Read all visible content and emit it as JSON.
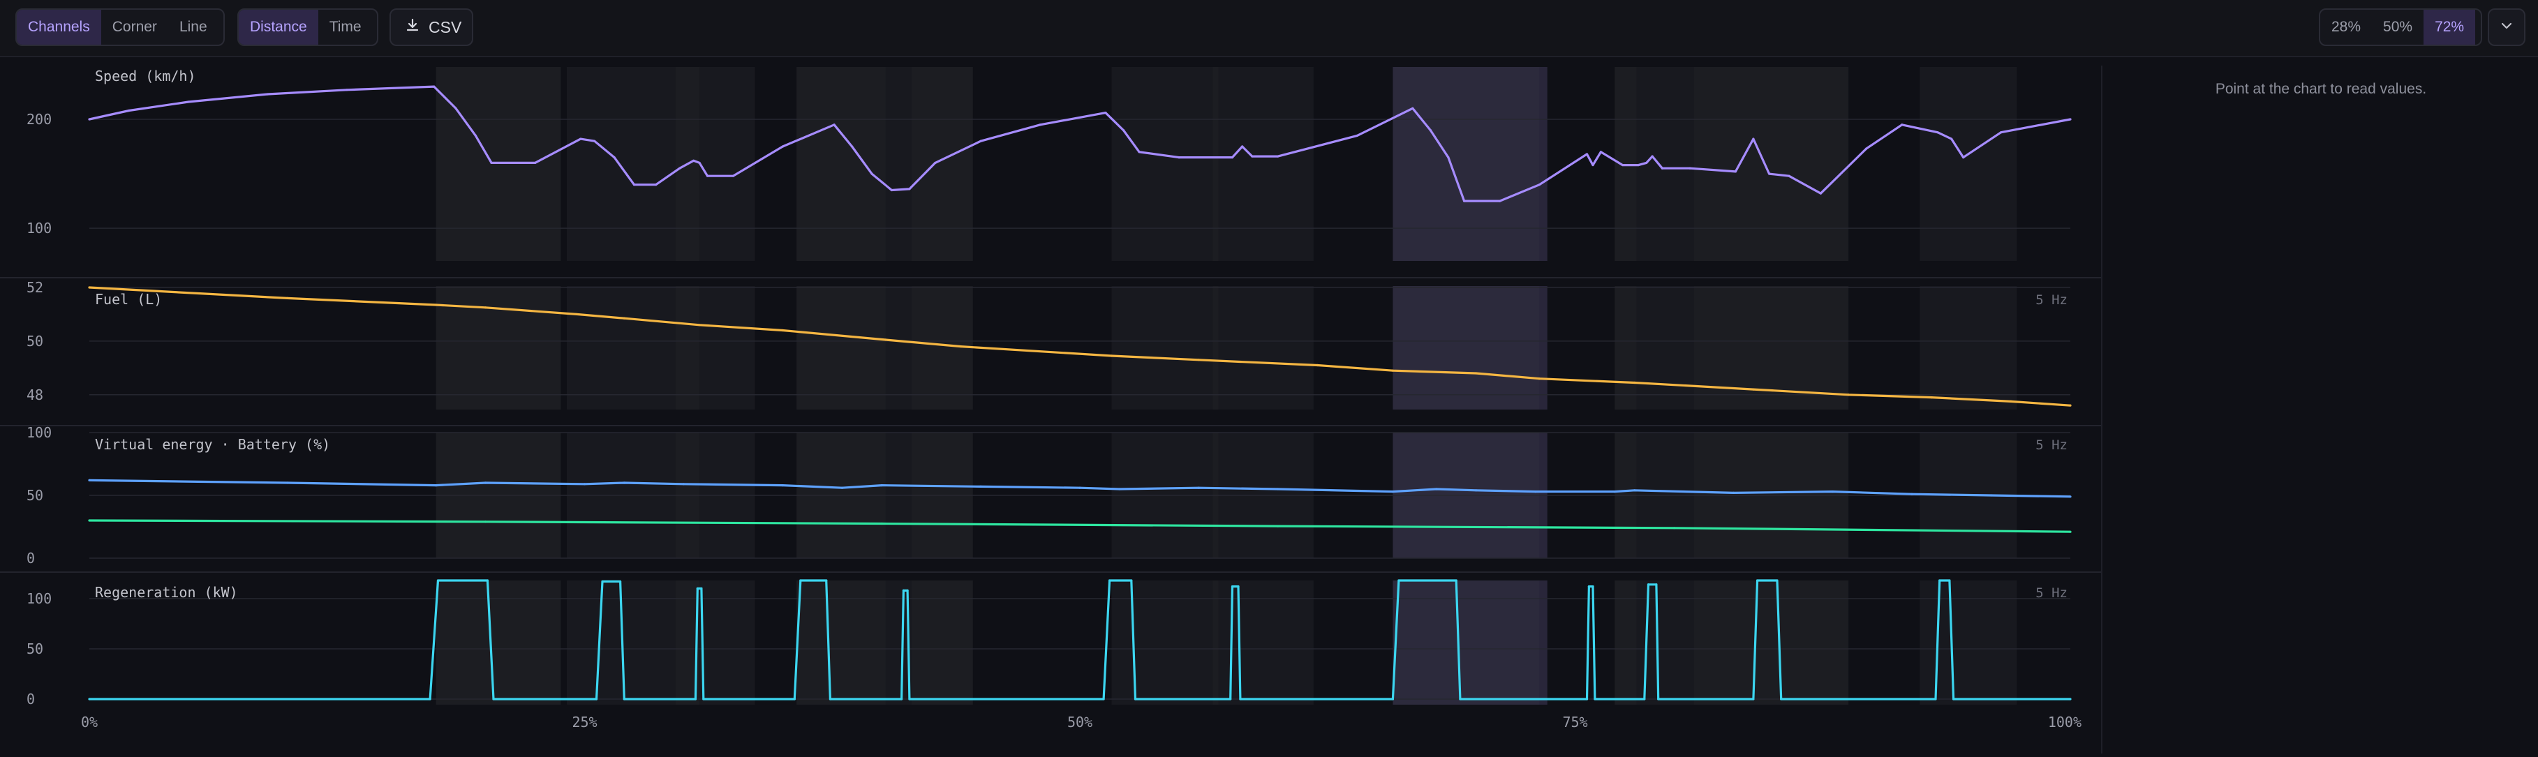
{
  "toolbar": {
    "view_mode": {
      "options": [
        "Channels",
        "Corner",
        "Line"
      ],
      "selected": "Channels"
    },
    "axis_mode": {
      "options": [
        "Distance",
        "Time"
      ],
      "selected": "Distance"
    },
    "export_label": "CSV",
    "zoom": {
      "options": [
        "28%",
        "50%",
        "72%"
      ],
      "selected": "72%"
    }
  },
  "side_panel": {
    "hint": "Point at the chart to read values."
  },
  "colors": {
    "accent": "#b6a3ff",
    "speed": "#a68cff",
    "fuel": "#f5b642",
    "battery": "#5ea2ff",
    "virtual_energy": "#2ee6a0",
    "regen": "#3cd6f0"
  },
  "chart_data": {
    "type": "line",
    "x_axis": {
      "labels": [
        "0%",
        "25%",
        "50%",
        "75%",
        "100%"
      ],
      "range": [
        0,
        100
      ]
    },
    "highlight_zones": [
      [
        17.5,
        23.8
      ],
      [
        24.1,
        29.6
      ],
      [
        29.6,
        30.8
      ],
      [
        30.8,
        33.6
      ],
      [
        35.7,
        40.2
      ],
      [
        40.2,
        41.5
      ],
      [
        41.5,
        44.6
      ],
      [
        51.6,
        56.7
      ],
      [
        56.7,
        57.0
      ],
      [
        57.0,
        61.8
      ],
      [
        65.8,
        73.2
      ],
      [
        73.2,
        73.6
      ],
      [
        77.0,
        78.1
      ],
      [
        78.1,
        81.0
      ],
      [
        81.0,
        88.8
      ],
      [
        92.4,
        97.3
      ]
    ],
    "selected_zone": [
      65.8,
      73.6
    ],
    "panels": [
      {
        "label": "Speed (km/h)",
        "rate": "",
        "yticks": [
          "200",
          "100"
        ],
        "ytick_values": [
          200,
          100
        ],
        "ylim": [
          70,
          248
        ],
        "series": [
          {
            "color_key": "speed",
            "x": [
              0,
              2,
              5,
              9,
              13,
              17.4,
              18.5,
              19.5,
              20.3,
              22.5,
              24.8,
              25.5,
              26.5,
              27.5,
              28.6,
              29.8,
              30.5,
              30.8,
              31.2,
              32.5,
              35,
              37.6,
              38.5,
              39.5,
              40.5,
              41.4,
              42.7,
              45,
              48,
              51.3,
              52.2,
              53,
              55,
              57.7,
              58.2,
              58.7,
              60,
              64,
              66.8,
              67.7,
              68.6,
              69.4,
              71.2,
              73.2,
              75.6,
              75.9,
              76.3,
              77.4,
              78.2,
              78.6,
              78.9,
              79.4,
              80.8,
              83.1,
              84,
              84.8,
              85.8,
              87.4,
              89.7,
              91.5,
              93.3,
              94,
              94.6,
              96.5,
              100
            ],
            "y": [
              200,
              208,
              216,
              223,
              227,
              230,
              210,
              185,
              160,
              160,
              182,
              180,
              165,
              140,
              140,
              155,
              162,
              160,
              148,
              148,
              175,
              195,
              175,
              150,
              135,
              136,
              160,
              180,
              195,
              206,
              190,
              170,
              165,
              165,
              175,
              166,
              166,
              185,
              210,
              190,
              165,
              125,
              125,
              140,
              168,
              158,
              170,
              158,
              158,
              160,
              166,
              155,
              155,
              152,
              182,
              150,
              148,
              132,
              173,
              195,
              188,
              182,
              165,
              188,
              200
            ]
          }
        ]
      },
      {
        "label": "Fuel (L)",
        "rate": "5 Hz",
        "yticks": [
          "52",
          "50",
          "48"
        ],
        "ytick_values": [
          52,
          50,
          48
        ],
        "ylim": [
          47.5,
          52
        ],
        "series": [
          {
            "color_key": "fuel",
            "x": [
              0,
              10,
              17.5,
              20,
              24.6,
              27,
              30.8,
              35,
              40.2,
              44,
              51.6,
              56,
              62,
              65.8,
              70,
              73.2,
              78,
              84,
              88.8,
              93,
              97,
              100
            ],
            "y": [
              52.0,
              51.6,
              51.35,
              51.25,
              51.0,
              50.85,
              50.6,
              50.4,
              50.05,
              49.8,
              49.45,
              49.3,
              49.1,
              48.9,
              48.8,
              48.6,
              48.45,
              48.2,
              48.0,
              47.9,
              47.75,
              47.6
            ]
          }
        ]
      },
      {
        "label": "Virtual energy · Battery (%)",
        "rate": "5 Hz",
        "yticks": [
          "100",
          "50",
          "0"
        ],
        "ytick_values": [
          100,
          50,
          0
        ],
        "ylim": [
          0,
          100
        ],
        "series": [
          {
            "color_key": "battery",
            "x": [
              0,
              10,
              17.5,
              20,
              25,
              27,
              30,
              35,
              38,
              40,
              45,
              50,
              52,
              56,
              60,
              65.8,
              68,
              70,
              73,
              77,
              78,
              83,
              88,
              92,
              96,
              100
            ],
            "y": [
              62,
              60,
              58,
              60,
              59,
              60,
              59,
              58,
              56,
              58,
              57,
              56,
              55,
              56,
              55,
              53,
              55,
              54,
              53,
              53,
              54,
              52,
              53,
              51,
              50,
              49
            ]
          },
          {
            "color_key": "virtual_energy",
            "x": [
              0,
              20,
              40,
              60,
              80,
              100
            ],
            "y": [
              30,
              29,
              27.5,
              25.5,
              24,
              21
            ]
          }
        ]
      },
      {
        "label": "Regeneration (kW)",
        "rate": "5 Hz",
        "yticks": [
          "100",
          "50",
          "0"
        ],
        "ytick_values": [
          100,
          50,
          0
        ],
        "ylim": [
          0,
          118
        ],
        "series": [
          {
            "color_key": "regen",
            "x": [
              0,
              17.2,
              17.6,
              20.1,
              20.4,
              25.6,
              25.9,
              26.8,
              27.0,
              30.6,
              30.7,
              30.9,
              31.0,
              35.6,
              35.9,
              37.2,
              37.4,
              41.0,
              41.1,
              41.3,
              41.4,
              51.2,
              51.5,
              52.6,
              52.8,
              57.6,
              57.7,
              58.0,
              58.1,
              65.8,
              66.1,
              69.0,
              69.2,
              75.6,
              75.7,
              75.9,
              76.0,
              78.5,
              78.7,
              79.1,
              79.2,
              84.0,
              84.2,
              85.2,
              85.4,
              93.2,
              93.4,
              93.9,
              94.1,
              100
            ],
            "y": [
              0,
              0,
              118,
              118,
              0,
              0,
              117,
              117,
              0,
              0,
              110,
              110,
              0,
              0,
              118,
              118,
              0,
              0,
              108,
              108,
              0,
              0,
              118,
              118,
              0,
              0,
              112,
              112,
              0,
              0,
              118,
              118,
              0,
              0,
              112,
              112,
              0,
              0,
              114,
              114,
              0,
              0,
              118,
              118,
              0,
              0,
              118,
              118,
              0,
              0
            ]
          }
        ]
      }
    ]
  }
}
